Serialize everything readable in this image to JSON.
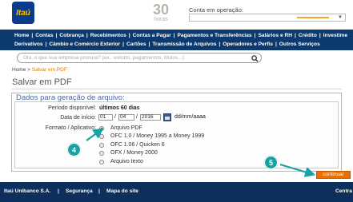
{
  "header": {
    "logo_text": "Itaú",
    "badge_number": "30",
    "badge_sub": "horas",
    "operation_label": "Conta em operação:"
  },
  "nav": {
    "row1": [
      "Home",
      "Contas",
      "Cobrança",
      "Recebimentos",
      "Contas a Pagar",
      "Pagamentos e Transferências",
      "Salários e RH",
      "Crédito",
      "Investime"
    ],
    "row2": [
      "Derivativos",
      "Câmbio e Comércio Exterior",
      "Cartões",
      "Transmissão de Arquivos",
      "Operadores e Perfis",
      "Outros Serviços"
    ]
  },
  "search": {
    "placeholder": "Olá, o que sua empresa procura? (ex.: extrato, pagamentos, títulos...)"
  },
  "breadcrumb": {
    "home": "Home",
    "sep": " > ",
    "current": "Salvar em PDF"
  },
  "page": {
    "title": "Salvar em PDF"
  },
  "form": {
    "section_title": "Dados para geração de arquivo:",
    "period_label": "Período disponível:",
    "period_value": "últimos 60 dias",
    "start_label": "Data de início:",
    "day": "01",
    "month": "04",
    "year": "2016",
    "date_hint": "dd/mm/aaaa",
    "format_label": "Formato / Aplicativo:",
    "options": [
      {
        "label": "Arquivo PDF",
        "selected": true
      },
      {
        "label": "OFC 1.0 / Money 1995 a Money 1999",
        "selected": false
      },
      {
        "label": "OFC 1.06 / Quicken 6",
        "selected": false
      },
      {
        "label": "OFX / Money 2000",
        "selected": false
      },
      {
        "label": "Arquivo texto",
        "selected": false
      }
    ]
  },
  "callouts": {
    "step4": "4",
    "step5": "5",
    "color": "#17a3a6"
  },
  "actions": {
    "continue_label": "continuar"
  },
  "footer": {
    "company": "Itaú Unibanco S.A.",
    "security": "Segurança",
    "sitemap": "Mapa do site",
    "central": "Centra"
  },
  "colors": {
    "nav_bg": "#0c3a6e",
    "accent": "#ec7000",
    "footer_bg": "#0c2f5c"
  }
}
